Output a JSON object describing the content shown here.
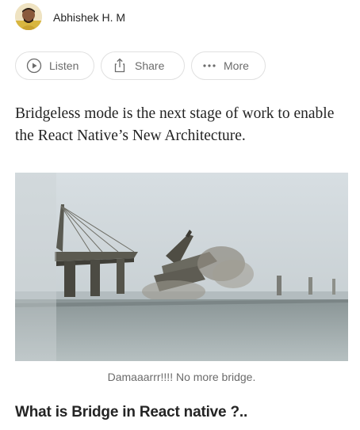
{
  "author": {
    "name": "Abhishek H. M"
  },
  "actions": {
    "listen_label": "Listen",
    "share_label": "Share",
    "more_label": "More"
  },
  "article": {
    "intro": "Bridgeless mode is the next stage of work to enable the React Native’s New Architecture.",
    "image_caption": "Damaaarrr!!!! No more bridge.",
    "section_heading": "What is Bridge in React native ?.."
  },
  "icons": {
    "listen": "play-circle-icon",
    "share": "share-icon",
    "more": "more-dots-icon"
  }
}
